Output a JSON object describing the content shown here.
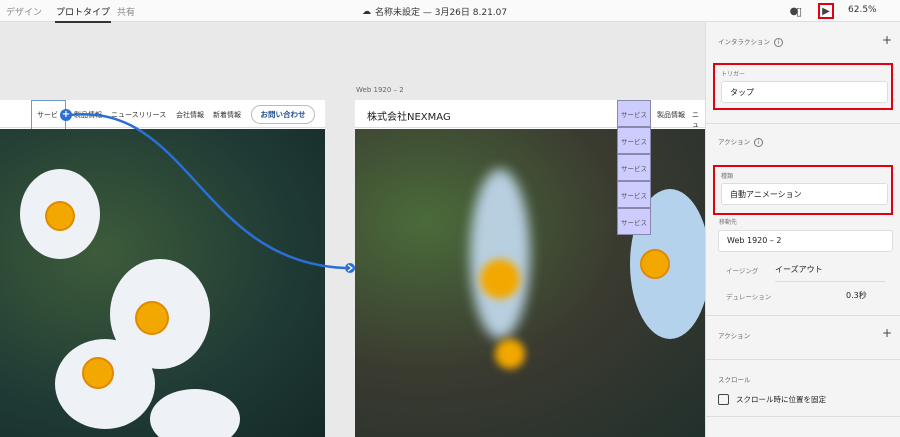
{
  "topbar": {
    "tabs": [
      "デザイン",
      "プロトタイプ",
      "共有"
    ],
    "active_tab": "プロトタイプ",
    "doc_title": "名称未設定 — 3月26日 8.21.07",
    "zoom": "62.5%"
  },
  "artboard1": {
    "nav": [
      "サービ",
      "製品情報",
      "ニュースリリース",
      "会社情報",
      "新着情報"
    ],
    "contact": "お問い合わせ"
  },
  "artboard2": {
    "label": "Web 1920 – 2",
    "logo": "株式会社NEXMAG",
    "nav": [
      "サービス",
      "製品情報",
      "ニュ"
    ],
    "dropdown": [
      "サービス",
      "サービス",
      "サービス",
      "サービス"
    ]
  },
  "panel": {
    "interaction_label": "インタラクション",
    "trigger_label": "トリガー",
    "trigger_value": "タップ",
    "action_label": "アクション",
    "type_label": "種類",
    "type_value": "自動アニメーション",
    "destination_label": "移動先",
    "destination_value": "Web 1920 – 2",
    "easing_label": "イージング",
    "easing_value": "イーズアウト",
    "duration_label": "デュレーション",
    "duration_value": "0.3秒",
    "action2_label": "アクション",
    "scroll_label": "スクロール",
    "scroll_checkbox": "スクロール時に位置を固定"
  },
  "colors": {
    "accent": "#2b6fd6",
    "highlight": "#e00010",
    "dropdown": "#ccccff"
  }
}
